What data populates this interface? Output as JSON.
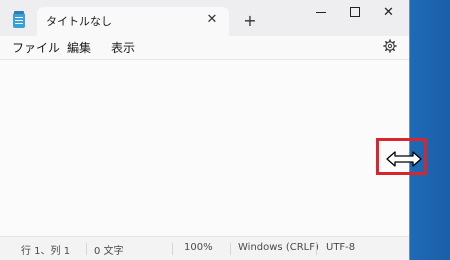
{
  "window": {
    "tab_title": "タイトルなし"
  },
  "icons": {
    "app": "notepad-icon",
    "tab_close": "close-icon",
    "new_tab": "plus-icon",
    "minimize": "minimize-icon",
    "maximize": "maximize-icon",
    "close": "close-icon",
    "settings": "gear-icon",
    "cursor": "horizontal-resize-cursor-icon"
  },
  "menu": {
    "file": "ファイル",
    "edit": "編集",
    "view": "表示"
  },
  "editor": {
    "content": ""
  },
  "status": {
    "position": "行 1、列 1",
    "char_count": "0 文字",
    "zoom": "100%",
    "line_ending": "Windows (CRLF)",
    "encoding": "UTF-8"
  },
  "colors": {
    "highlight_border": "#d9252c",
    "desktop": "#1c62ac"
  }
}
